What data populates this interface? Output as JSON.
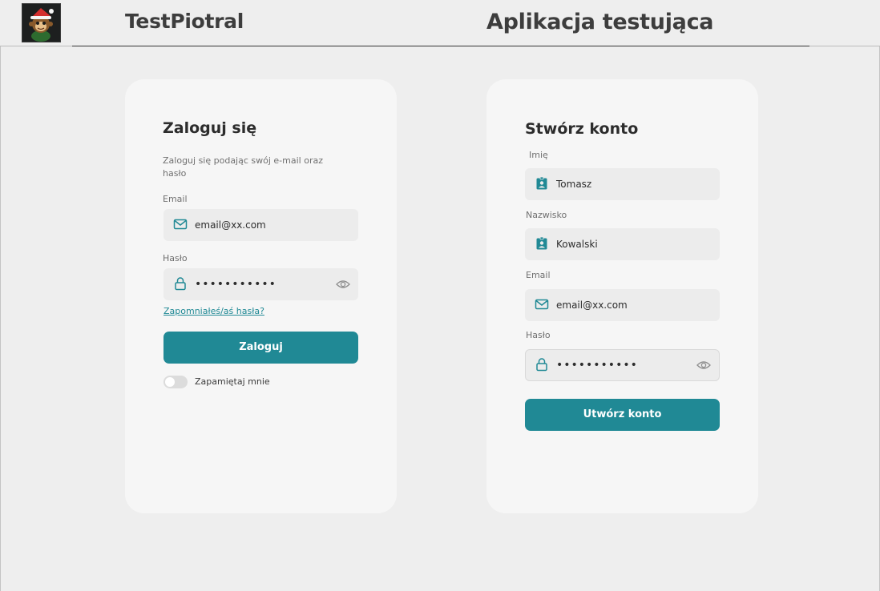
{
  "header": {
    "brand": "TestPiotral",
    "app_title": "Aplikacja testująca"
  },
  "login": {
    "title": "Zaloguj się",
    "description": "Zaloguj się podając swój e-mail oraz hasło",
    "email_label": "Email",
    "email_value": "email@xx.com",
    "password_label": "Hasło",
    "password_value": "•••••••••••",
    "forgot_link": "Zapomniałeś/aś hasła?",
    "submit_label": "Zaloguj",
    "remember_label": "Zapamiętaj mnie",
    "remember_checked": false
  },
  "register": {
    "title": "Stwórz konto",
    "first_name_label": "Imię",
    "first_name_value": "Tomasz",
    "last_name_label": "Nazwisko",
    "last_name_value": "Kowalski",
    "email_label": "Email",
    "email_value": "email@xx.com",
    "password_label": "Hasło",
    "password_value": "•••••••••••",
    "submit_label": "Utwórz konto"
  },
  "icons": {
    "email": "envelope-icon",
    "password": "lock-icon",
    "person": "contact-badge-icon",
    "visibility": "eye-icon"
  },
  "colors": {
    "accent": "#208995",
    "background": "#eeeeee",
    "card": "#f6f6f6",
    "field": "#ececec"
  }
}
